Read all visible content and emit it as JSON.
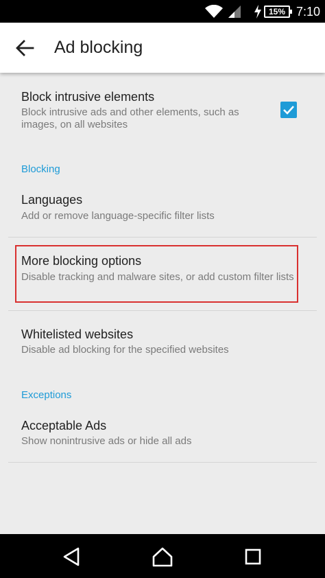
{
  "status_bar": {
    "battery": "15%",
    "time": "7:10",
    "icons": [
      "wifi-icon",
      "signal-icon",
      "charging-icon",
      "battery-icon"
    ]
  },
  "app_bar": {
    "title": "Ad blocking",
    "back_icon": "arrow-left-icon"
  },
  "prefs": {
    "block_intrusive": {
      "title": "Block intrusive elements",
      "summary": "Block intrusive ads and other elements, such as images, on all websites",
      "checked": true
    },
    "blocking_header": "Blocking",
    "languages": {
      "title": "Languages",
      "summary": "Add or remove language-specific filter lists"
    },
    "more_blocking": {
      "title": "More blocking options",
      "summary": "Disable tracking and malware sites, or add custom filter lists"
    },
    "whitelisted": {
      "title": "Whitelisted websites",
      "summary": "Disable ad blocking for the specified websites"
    },
    "exceptions_header": "Exceptions",
    "acceptable_ads": {
      "title": "Acceptable Ads",
      "summary": "Show nonintrusive ads or hide all ads"
    }
  },
  "colors": {
    "accent": "#1e9bd7",
    "highlight_border": "#d9302f",
    "background": "#ececec"
  },
  "nav_bar": {
    "icons": [
      "back-triangle-icon",
      "home-icon",
      "recents-icon"
    ]
  }
}
